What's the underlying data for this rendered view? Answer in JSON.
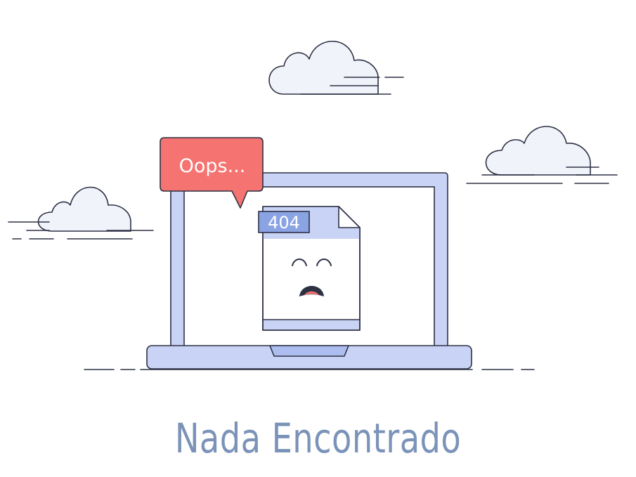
{
  "illustration": {
    "speech_bubble_text": "Oops...",
    "error_code": "404"
  },
  "headline": "Nada Encontrado",
  "colors": {
    "laptop_fill": "#c9d3f5",
    "outline": "#2d3144",
    "bubble_fill": "#f57370",
    "cloud_fill": "#f1f3fb",
    "headline": "#7b93b8"
  }
}
